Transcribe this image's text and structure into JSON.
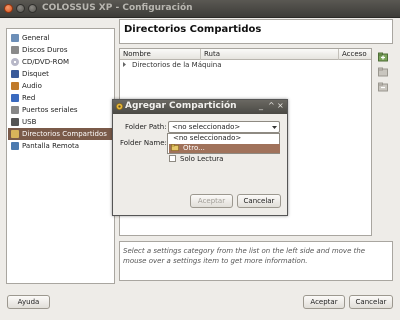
{
  "window": {
    "title": "COLOSSUS XP - Configuración"
  },
  "sidebar": {
    "items": [
      {
        "label": "General",
        "icon": "general-icon",
        "color": "#6d8fb8"
      },
      {
        "label": "Discos Duros",
        "icon": "hard-disk-icon",
        "color": "#8a8a8a"
      },
      {
        "label": "CD/DVD-ROM",
        "icon": "cdrom-icon",
        "color": "#b8b8c8"
      },
      {
        "label": "Disquet",
        "icon": "floppy-icon",
        "color": "#3a5a9a"
      },
      {
        "label": "Audio",
        "icon": "audio-icon",
        "color": "#c07a2a"
      },
      {
        "label": "Red",
        "icon": "network-icon",
        "color": "#3a6abf"
      },
      {
        "label": "Puertos seriales",
        "icon": "serial-port-icon",
        "color": "#888888"
      },
      {
        "label": "USB",
        "icon": "usb-icon",
        "color": "#555555"
      },
      {
        "label": "Directorios Compartidos",
        "icon": "shared-folder-icon",
        "color": "#d8b35a",
        "selected": true
      },
      {
        "label": "Pantalla Remota",
        "icon": "remote-display-icon",
        "color": "#4a7ab0"
      }
    ]
  },
  "main": {
    "title": "Directorios Compartidos",
    "table": {
      "columns": [
        "Nombre",
        "Ruta",
        "Acceso"
      ],
      "rows": [
        {
          "label": "Directorios de la Máquina"
        }
      ]
    },
    "description": "Select a settings category from the list on the left side and move the mouse over a settings item to get more information."
  },
  "buttons": {
    "help": "Ayuda",
    "ok": "Aceptar",
    "cancel": "Cancelar"
  },
  "dialog": {
    "title": "Agregar Compartición",
    "folder_path_label": "Folder Path:",
    "folder_name_label": "Folder Name:",
    "combo_value": "<no seleccionado>",
    "options": [
      "<no seleccionado>",
      "Otro..."
    ],
    "readonly_label": "Solo Lectura",
    "ok": "Aceptar",
    "cancel": "Cancelar",
    "controls": {
      "minimize": "_",
      "restore": "^",
      "close": "×"
    }
  },
  "colors": {
    "selection": "#7a5a49",
    "highlight": "#a0725b",
    "titlebar": "#4a4944"
  }
}
